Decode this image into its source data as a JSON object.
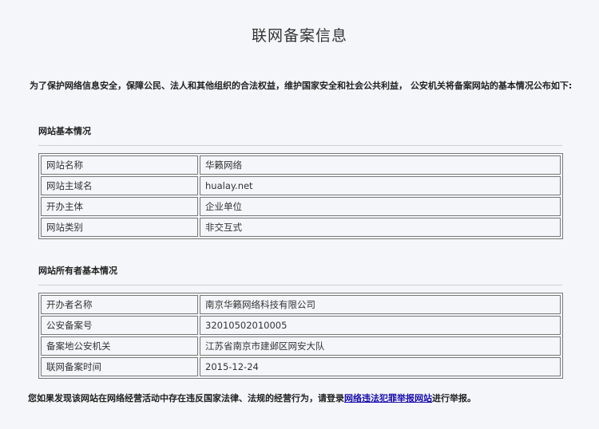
{
  "page": {
    "title": "联网备案信息",
    "intro": "为了保护网络信息安全，保障公民、法人和其他组织的合法权益，维护国家安全和社会公共利益， 公安机关将备案网站的基本情况公布如下:"
  },
  "website_info": {
    "heading": "网站基本情况",
    "rows": [
      {
        "label": "网站名称",
        "value": "华籁网络"
      },
      {
        "label": "网站主域名",
        "value": "hualay.net"
      },
      {
        "label": "开办主体",
        "value": "企业单位"
      },
      {
        "label": "网站类别",
        "value": "非交互式"
      }
    ]
  },
  "owner_info": {
    "heading": "网站所有者基本情况",
    "rows": [
      {
        "label": "开办者名称",
        "value": "南京华籁网络科技有限公司"
      },
      {
        "label": "公安备案号",
        "value": "32010502010005"
      },
      {
        "label": "备案地公安机关",
        "value": "江苏省南京市建邺区网安大队"
      },
      {
        "label": "联网备案时间",
        "value": "2015-12-24"
      }
    ]
  },
  "footer": {
    "prefix": "您如果发现该网站在网络经营活动中存在违反国家法律、法规的经营行为，请登录",
    "link": "网络违法犯罪举报网站",
    "suffix": "进行举报。"
  }
}
